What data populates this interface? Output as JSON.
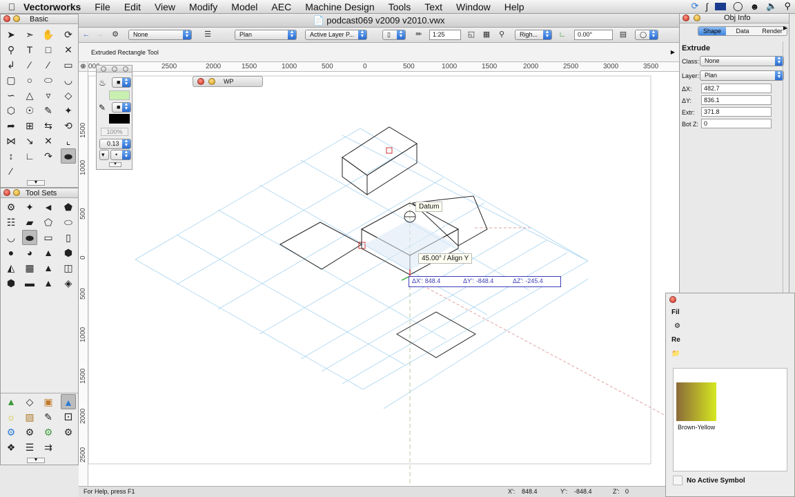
{
  "menubar": {
    "app_name": "Vectorworks",
    "items": [
      "File",
      "Edit",
      "View",
      "Modify",
      "Model",
      "AEC",
      "Machine Design",
      "Tools",
      "Text",
      "Window",
      "Help"
    ]
  },
  "document": {
    "title": "podcast069 v2009 v2010.vwx"
  },
  "viewbar": {
    "class_popup": "None",
    "view_popup": "Plan",
    "layer_popup": "Active Layer P...",
    "scale": "1:25",
    "render_popup": "Righ...",
    "angle": "0.00°"
  },
  "modebar": {
    "tool_name": "Extruded Rectangle Tool"
  },
  "ruler": {
    "h_ticks": [
      "000",
      "2500",
      "2000",
      "1500",
      "1000",
      "500",
      "0",
      "500",
      "1000",
      "1500",
      "2000",
      "2500",
      "3000",
      "3500"
    ],
    "v_ticks": [
      "1500",
      "1000",
      "500",
      "0",
      "500",
      "1000",
      "1500",
      "2000",
      "2500"
    ]
  },
  "palettes": {
    "basic_title": "Basic",
    "toolsets_title": "Tool Sets",
    "wp_title": "WP"
  },
  "attributes": {
    "opacity": "100%",
    "line_weight": "0.13",
    "fill_color": "#c9efb1",
    "pen_color": "#000000"
  },
  "canvas": {
    "datum_label": "Datum",
    "align_label": "45.00°  /  Align Y",
    "dx": "ΔX':  848.4",
    "dy": "ΔY':  -848.4",
    "dz": "ΔZ':  -245.4"
  },
  "statusbar": {
    "help": "For Help, press F1",
    "x_label": "X':",
    "x_value": "848.4",
    "y_label": "Y':",
    "y_value": "-848.4",
    "z_label": "Z':",
    "z_value": "0"
  },
  "oip": {
    "title": "Obj Info",
    "tabs": [
      "Shape",
      "Data",
      "Render"
    ],
    "object_type": "Extrude",
    "fields": [
      {
        "label": "Class:",
        "value": "None",
        "kind": "popup"
      },
      {
        "label": "Layer:",
        "value": "Plan",
        "kind": "popup"
      },
      {
        "label": "ΔX:",
        "value": "482.7",
        "kind": "field"
      },
      {
        "label": "ΔY:",
        "value": "836.1",
        "kind": "field"
      },
      {
        "label": "Extr:",
        "value": "371.8",
        "kind": "field"
      },
      {
        "label": "Bot Z:",
        "value": "0",
        "kind": "field"
      }
    ]
  },
  "resource_browser": {
    "label_fi": "Fil",
    "label_re": "Re",
    "resource_name": "Brown-Yellow",
    "active_symbol": "No Active Symbol"
  }
}
